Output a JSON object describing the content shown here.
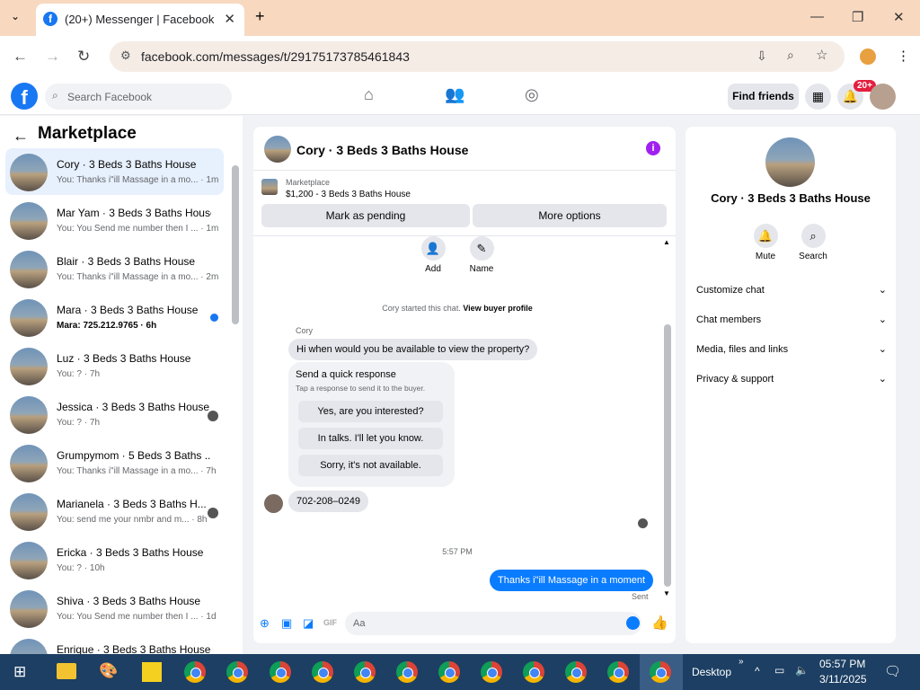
{
  "browser": {
    "tab_title": "(20+) Messenger | Facebook",
    "url": "facebook.com/messages/t/29175173785461843"
  },
  "fb": {
    "search_placeholder": "Search Facebook",
    "find_friends": "Find friends",
    "notif_badge": "20+"
  },
  "sidebar": {
    "title": "Marketplace",
    "conversations": [
      {
        "name": "Cory · 3 Beds 3 Baths House",
        "snippet": "You: Thanks i\"ill Massage in a mo... · 1m"
      },
      {
        "name": "Mar Yam · 3 Beds 3 Baths House",
        "snippet": "You: You Send me number then I ... · 1m"
      },
      {
        "name": "Blair · 3 Beds 3 Baths House",
        "snippet": "You: Thanks i\"ill Massage in a mo... · 2m"
      },
      {
        "name": "Mara · 3 Beds 3 Baths House",
        "snippet": "Mara: 725.212.9765 · 6h"
      },
      {
        "name": "Luz · 3 Beds 3 Baths House",
        "snippet": "You: ? · 7h"
      },
      {
        "name": "Jessica · 3 Beds 3 Baths House",
        "snippet": "You: ? · 7h"
      },
      {
        "name": "Grumpymom · 5 Beds 3 Baths ...",
        "snippet": "You: Thanks i\"ill Massage in a mo... · 7h"
      },
      {
        "name": "Marianela · 3 Beds 3 Baths H...",
        "snippet": "You: send me your nmbr and m... · 8h"
      },
      {
        "name": "Ericka · 3 Beds 3 Baths House",
        "snippet": "You: ? · 10h"
      },
      {
        "name": "Shiva · 3 Beds 3 Baths House",
        "snippet": "You: You Send me number then I ... · 1d"
      },
      {
        "name": "Enrique · 3 Beds 3 Baths House",
        "snippet": ""
      }
    ]
  },
  "chat": {
    "title": "Cory · 3 Beds 3 Baths House",
    "marketplace_label": "Marketplace",
    "listing": "$1,200 - 3 Beds 3 Baths House",
    "mark_pending": "Mark as pending",
    "more_options": "More options",
    "add_label": "Add",
    "name_label": "Name",
    "started_text": "Cory started this chat.",
    "buyer_profile": "View buyer profile",
    "sender": "Cory",
    "msg1": "Hi when would you be available to view the property?",
    "quick_title": "Send a quick response",
    "quick_sub": "Tap a response to send it to the buyer.",
    "quick_options": [
      "Yes, are you interested?",
      "In talks. I'll let you know.",
      "Sorry, it's not available."
    ],
    "msg2": "702-208–0249",
    "time": "5:57 PM",
    "my_msg": "Thanks i\"ill Massage in a moment",
    "sent": "Sent",
    "composer_placeholder": "Aa",
    "gif": "GIF"
  },
  "panel": {
    "title": "Cory · 3 Beds 3 Baths House",
    "mute": "Mute",
    "search": "Search",
    "rows": [
      "Customize chat",
      "Chat members",
      "Media, files and links",
      "Privacy & support"
    ]
  },
  "taskbar": {
    "desktop": "Desktop",
    "time": "05:57 PM",
    "date": "3/11/2025"
  }
}
